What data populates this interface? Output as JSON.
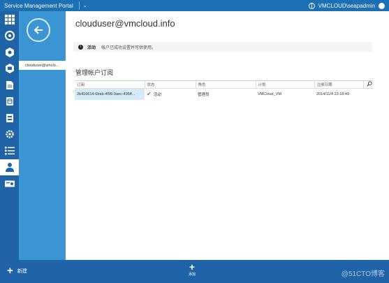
{
  "topbar": {
    "title": "Service Management Portal",
    "username": "VMCLOUD\\seapadmin"
  },
  "rail": {
    "items": [
      {
        "icon": "grid-icon",
        "active": false
      },
      {
        "icon": "globe-icon",
        "active": false
      },
      {
        "icon": "hexagon-icon",
        "active": false
      },
      {
        "icon": "monitor-icon",
        "active": false
      },
      {
        "icon": "document-icon",
        "active": false
      },
      {
        "icon": "database-icon",
        "active": false
      },
      {
        "icon": "server-icon",
        "active": false
      },
      {
        "icon": "gear-icon",
        "active": false
      },
      {
        "icon": "list-icon",
        "active": false
      },
      {
        "icon": "user-icon",
        "active": true
      },
      {
        "icon": "card-icon",
        "active": false
      }
    ]
  },
  "panel": {
    "selected_item": "clouduser@vmclo..."
  },
  "main": {
    "title": "clouduser@vmcloud.info",
    "status_label": "活动",
    "status_message": "帐户已成功设置并可供使用。",
    "section_title": "管理帐户订阅",
    "columns": [
      "订阅",
      "状态",
      "角色",
      "计划",
      "注册日期"
    ],
    "rows": [
      {
        "subscription": "2b416614-6bab-4f99-9aec-495ff...",
        "status": "活动",
        "role": "管理员",
        "plan": "VMCloud_VM",
        "registered": "2014/11/4 23:18:49"
      }
    ]
  },
  "bottombar": {
    "new_label": "新建",
    "add_label": "添加",
    "watermark": "@51CTO博客"
  },
  "colors": {
    "topbar": "#1a6fb5",
    "rail": "#1e64a6",
    "panel": "#3a95d2",
    "selected_row": "#d6ebf9",
    "check": "#2fa52f"
  }
}
